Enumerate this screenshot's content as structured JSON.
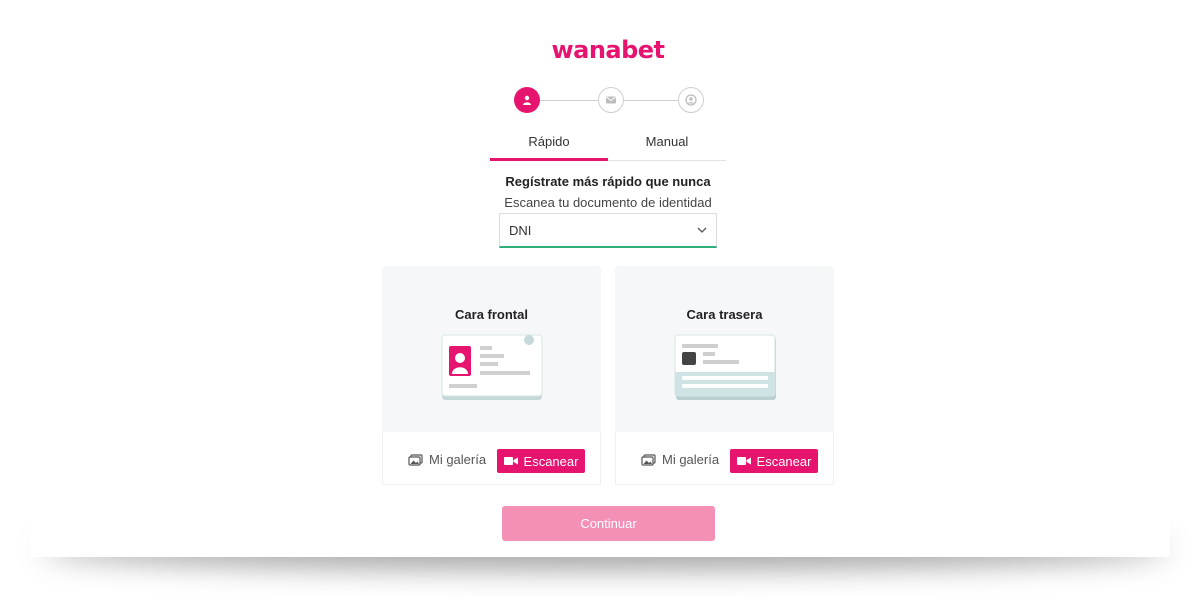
{
  "brand": {
    "logo_text": "wanabet",
    "accent": "#e6146f",
    "accent_disabled": "#f48fb6"
  },
  "stepper": [
    {
      "icon": "user-icon",
      "state": "active"
    },
    {
      "icon": "mail-icon",
      "state": "inactive"
    },
    {
      "icon": "account-circle-icon",
      "state": "inactive"
    }
  ],
  "tabs": [
    {
      "label": "Rápido",
      "active": true
    },
    {
      "label": "Manual",
      "active": false
    }
  ],
  "intro": {
    "headline": "Regístrate más rápido que nunca",
    "subline": "Escanea tu documento de identidad"
  },
  "document_select": {
    "value": "DNI"
  },
  "cards": [
    {
      "title": "Cara frontal",
      "gallery_label": "Mi galería",
      "scan_label": "Escanear",
      "illustration": "id-card-front"
    },
    {
      "title": "Cara trasera",
      "gallery_label": "Mi galería",
      "scan_label": "Escanear",
      "illustration": "id-card-back"
    }
  ],
  "continue_label": "Continuar"
}
